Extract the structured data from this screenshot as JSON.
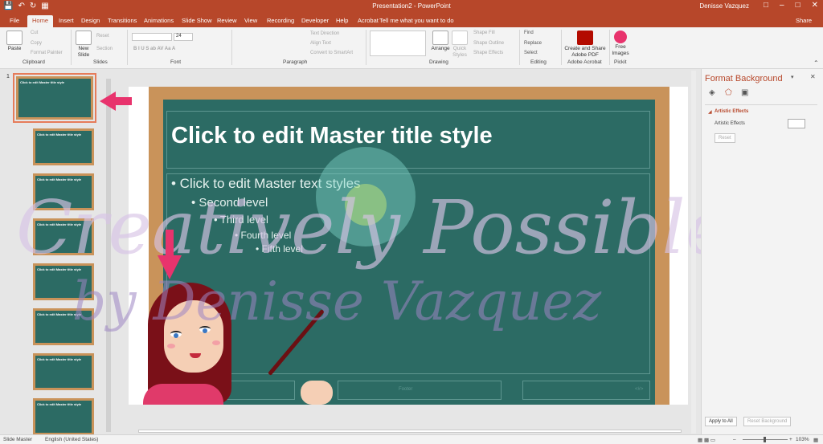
{
  "window": {
    "title": "Presentation2 - PowerPoint",
    "user": "Denisse Vazquez"
  },
  "tabs": {
    "file": "File",
    "home": "Home",
    "insert": "Insert",
    "design": "Design",
    "transitions": "Transitions",
    "animations": "Animations",
    "slide_show": "Slide Show",
    "review": "Review",
    "view": "View",
    "recording": "Recording",
    "developer": "Developer",
    "help": "Help",
    "acrobat": "Acrobat",
    "tell_me": "Tell me what you want to do",
    "share": "Share"
  },
  "ribbon": {
    "clipboard": {
      "paste": "Paste",
      "cut": "Cut",
      "copy": "Copy",
      "format_painter": "Format Painter",
      "label": "Clipboard"
    },
    "slides": {
      "new_slide": "New Slide",
      "reset": "Reset",
      "section": "Section",
      "label": "Slides"
    },
    "font": {
      "size": "24",
      "label": "Font"
    },
    "paragraph": {
      "text_direction": "Text Direction",
      "align_text": "Align Text",
      "convert_smartart": "Convert to SmartArt",
      "label": "Paragraph"
    },
    "drawing": {
      "arrange": "Arrange",
      "quick_styles": "Quick Styles",
      "shape_fill": "Shape Fill",
      "shape_outline": "Shape Outline",
      "shape_effects": "Shape Effects",
      "label": "Drawing"
    },
    "editing": {
      "find": "Find",
      "replace": "Replace",
      "select": "Select",
      "label": "Editing"
    },
    "acrobat": {
      "create_share": "Create and Share Adobe PDF",
      "label": "Adobe Acrobat"
    },
    "pickit": {
      "free_images": "Free Images",
      "label": "Pickit"
    }
  },
  "thumbnails": {
    "first_number": "1",
    "items": [
      {
        "title": "Click to edit Master title style"
      },
      {
        "title": "Click to edit Master title style"
      },
      {
        "title": "Click to edit Master title style"
      },
      {
        "title": "Click to edit Master title style"
      },
      {
        "title": "Click to edit Master title style"
      },
      {
        "title": "Click to edit Master title style"
      },
      {
        "title": "Click to edit Master title style"
      },
      {
        "title": "Click to edit Master title style"
      }
    ]
  },
  "slide": {
    "title": "Click to edit Master title style",
    "levels": [
      "• Click to edit Master text styles",
      "• Second level",
      "• Third level",
      "• Fourth level",
      "• Fifth level"
    ],
    "footer": "Footer",
    "page_num": "<#>"
  },
  "watermark": {
    "line1": "Creatively Possible",
    "line2": "by Denisse Vazquez"
  },
  "format_pane": {
    "title": "Format Background",
    "section": "Artistic Effects",
    "field_label": "Artistic Effects",
    "reset": "Reset",
    "apply_all": "Apply to All",
    "reset_background": "Reset Background"
  },
  "status": {
    "view": "Slide Master",
    "language": "English (United States)",
    "zoom": "103%"
  },
  "colors": {
    "accent": "#b7472a",
    "chalkboard": "#2c6b64",
    "frame": "#c9935a",
    "arrow": "#e8336d"
  }
}
